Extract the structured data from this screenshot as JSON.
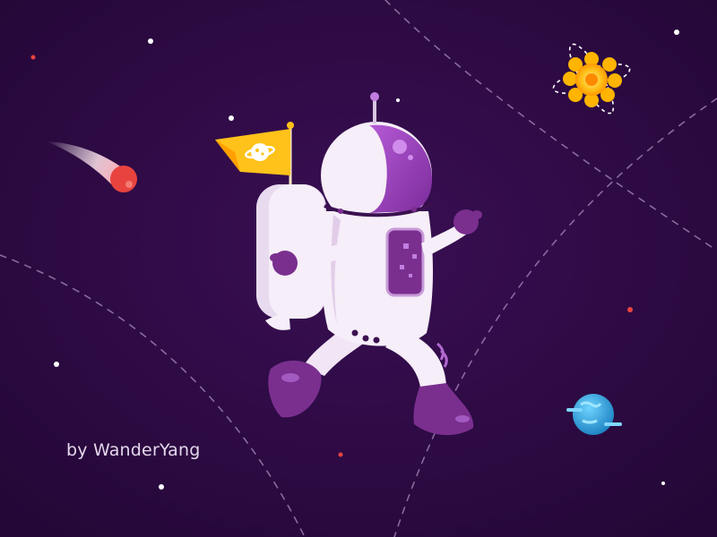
{
  "credit": {
    "text": "by WanderYang"
  },
  "colors": {
    "background": "#2a0a3e",
    "suit": "#f6eef8",
    "suit_shadow": "#e2cde9",
    "purple": "#7a2f8f",
    "flag": "#ffc21a",
    "comet": "#e8433f",
    "sun": "#ffb400",
    "planet": "#2fa4de"
  },
  "icons": [
    "comet-icon",
    "sun-icon",
    "planet-icon",
    "flag-icon",
    "astronaut-icon"
  ]
}
